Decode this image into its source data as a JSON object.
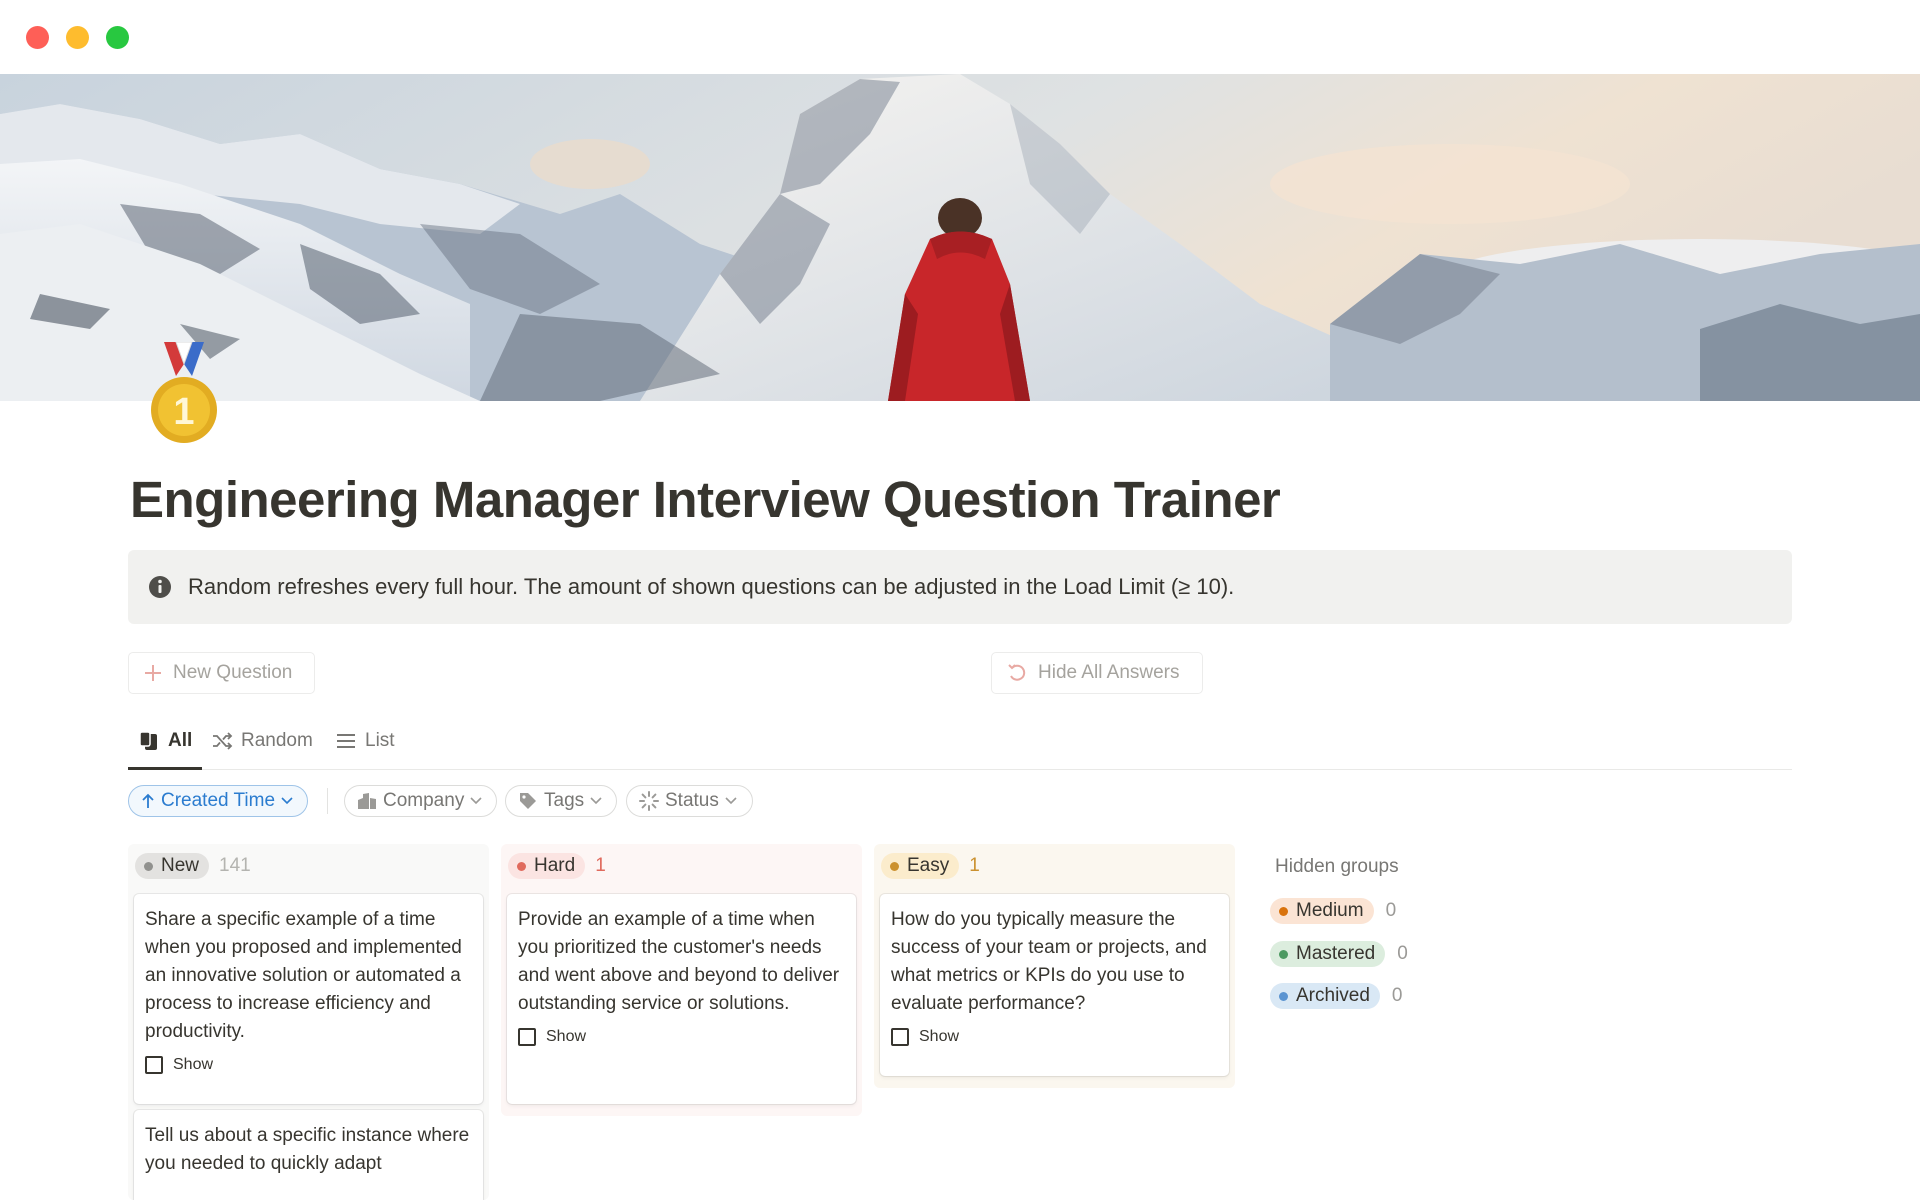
{
  "window": {
    "controls": [
      "close",
      "minimize",
      "zoom"
    ]
  },
  "cover": {
    "description_icon": "mountain-cover-image"
  },
  "page": {
    "icon": "first-place-medal-icon",
    "title": "Engineering Manager Interview Question Trainer"
  },
  "callout": {
    "icon": "info-icon",
    "text": "Random refreshes every full hour. The amount of shown questions can be adjusted in the Load Limit (≥ 10)."
  },
  "buttons": {
    "new_question": "New Question",
    "hide_answers": "Hide All Answers"
  },
  "tabs": [
    {
      "label": "All",
      "icon": "cards-icon",
      "active": true
    },
    {
      "label": "Random",
      "icon": "shuffle-icon",
      "active": false
    },
    {
      "label": "List",
      "icon": "list-icon",
      "active": false
    }
  ],
  "filters": {
    "sort": "Created Time",
    "company": "Company",
    "tags": "Tags",
    "status": "Status"
  },
  "columns": [
    {
      "name": "New",
      "count": "141",
      "cards": [
        {
          "text": "Share a specific example of a time when you proposed and implemented an innovative solution or automated a process to increase efficiency and productivity.",
          "show": "Show"
        },
        {
          "text": "Tell us about a specific instance where you needed to quickly adapt",
          "show": ""
        }
      ]
    },
    {
      "name": "Hard",
      "count": "1",
      "cards": [
        {
          "text": "Provide an example of a time when you prioritized the customer's needs and went above and beyond to deliver outstanding service or solutions.",
          "show": "Show"
        }
      ]
    },
    {
      "name": "Easy",
      "count": "1",
      "cards": [
        {
          "text": "How do you typically measure the success of your team or projects, and what metrics or KPIs do you use to evaluate performance?",
          "show": "Show"
        }
      ]
    }
  ],
  "hidden_groups": {
    "title": "Hidden groups",
    "items": [
      {
        "name": "Medium",
        "count": "0"
      },
      {
        "name": "Mastered",
        "count": "0"
      },
      {
        "name": "Archived",
        "count": "0"
      }
    ]
  },
  "colors": {
    "accent_blue": "#2b7ccf",
    "hard_red": "#e06a5d",
    "easy_yellow": "#cb912f",
    "medium_orange": "#d9730d",
    "mastered_green": "#4d9a62",
    "archived_blue": "#5b94d1"
  }
}
